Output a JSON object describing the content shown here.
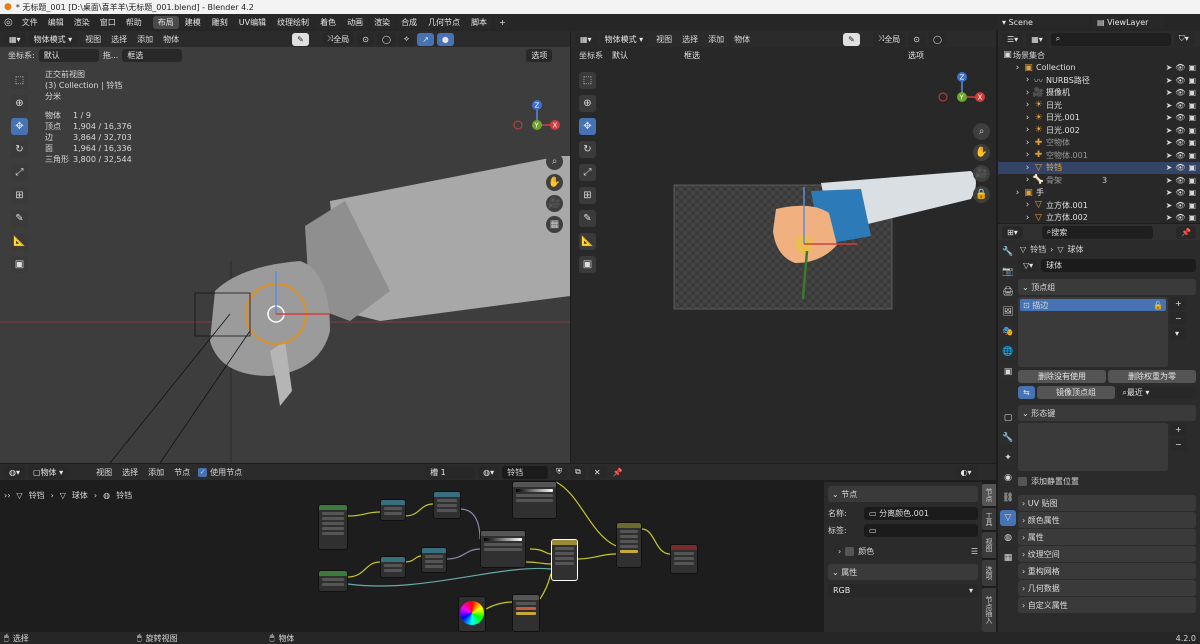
{
  "titlebar": {
    "title": "* 无标题_001 [D:\\桌面\\喜羊羊\\无标题_001.blend] - Blender 4.2"
  },
  "menu": [
    "文件",
    "编辑",
    "渲染",
    "窗口",
    "帮助"
  ],
  "workspaces": [
    "布局",
    "建模",
    "雕刻",
    "UV编辑",
    "纹理绘制",
    "着色",
    "动画",
    "渲染",
    "合成",
    "几何节点",
    "脚本"
  ],
  "active_workspace": "布局",
  "scene": {
    "name": "Scene",
    "view_layer": "ViewLayer"
  },
  "viewport_left": {
    "mode": "物体模式",
    "menus": [
      "视图",
      "选择",
      "添加",
      "物体"
    ],
    "global": "全局",
    "coord_label": "坐标系:",
    "coord_value": "默认",
    "drag_label": "拖...",
    "select_mode": "框选",
    "options": "选项",
    "view_name": "正交前视图",
    "collection_line": "(3) Collection | 铃铛",
    "unit": "分米",
    "stats": [
      {
        "label": "物体",
        "value": "1 / 9"
      },
      {
        "label": "顶点",
        "value": "1,904 / 16,376"
      },
      {
        "label": "边",
        "value": "3,864 / 32,703"
      },
      {
        "label": "面",
        "value": "1,964 / 16,336"
      },
      {
        "label": "三角形",
        "value": "3,800 / 32,544"
      }
    ]
  },
  "viewport_right": {
    "mode": "物体模式",
    "menus": [
      "视图",
      "选择",
      "添加",
      "物体"
    ],
    "global": "全局",
    "coord_label": "坐标系",
    "coord_value": "默认",
    "select_mode": "框选",
    "options": "选项"
  },
  "gizmo": {
    "x": "X",
    "y": "Y",
    "z": "Z"
  },
  "outliner": {
    "search_placeholder": "",
    "root": "场景集合",
    "items": [
      {
        "label": "Collection",
        "color": "#e0e0e0",
        "indent": 1
      },
      {
        "label": "NURBS路径",
        "color": "#e0e0e0",
        "indent": 2
      },
      {
        "label": "摄像机",
        "color": "#e0e0e0",
        "indent": 2
      },
      {
        "label": "日光",
        "color": "#e0e0e0",
        "indent": 2
      },
      {
        "label": "日光.001",
        "color": "#e0e0e0",
        "indent": 2
      },
      {
        "label": "日光.002",
        "color": "#e0e0e0",
        "indent": 2
      },
      {
        "label": "空物体",
        "color": "#9a9a9a",
        "indent": 2
      },
      {
        "label": "空物体.001",
        "color": "#9a9a9a",
        "indent": 2
      },
      {
        "label": "铃铛",
        "color": "#f0b040",
        "indent": 2
      },
      {
        "label": "骨架",
        "color": "#9a9a9a",
        "indent": 2
      },
      {
        "label": "手",
        "color": "#e0e0e0",
        "indent": 1
      },
      {
        "label": "立方体.001",
        "color": "#e0e0e0",
        "indent": 2
      },
      {
        "label": "立方体.002",
        "color": "#e0e0e0",
        "indent": 2
      }
    ],
    "badge_3": "3"
  },
  "properties": {
    "search_placeholder": "搜索",
    "breadcrumb_obj": "铃铛",
    "breadcrumb_data": "球体",
    "mesh_name": "球体",
    "vertex_groups_title": "顶点组",
    "vertex_group_item": "描边",
    "remove_unused": "删除没有使用",
    "remove_zero": "删除权重为零",
    "mirror_group": "镜像顶点组",
    "nearest": "最近",
    "shape_keys_title": "形态键",
    "add_rest_position": "添加静置位置",
    "sections": [
      "UV 贴图",
      "颜色属性",
      "属性",
      "纹理空间",
      "重构网格",
      "几何数据",
      "自定义属性"
    ]
  },
  "node_editor": {
    "object": "物体",
    "menus": [
      "视图",
      "选择",
      "添加",
      "节点"
    ],
    "use_nodes": "使用节点",
    "slot": "槽 1",
    "material": "铃铛",
    "breadcrumb": [
      "铃铛",
      "球体",
      "铃铛"
    ]
  },
  "node_sidebar": {
    "node_title": "节点",
    "name_label": "名称:",
    "name_value": "分离颜色.001",
    "label_label": "标签:",
    "label_value": "",
    "color_label": "颜色",
    "props_title": "属性",
    "props_value": "RGB",
    "tabs": [
      "节点",
      "工具",
      "视图",
      "选项",
      "节点插入"
    ]
  },
  "statusbar": {
    "select": "选择",
    "rotate": "旋转视图",
    "object": "物体",
    "version": "4.2.0"
  }
}
